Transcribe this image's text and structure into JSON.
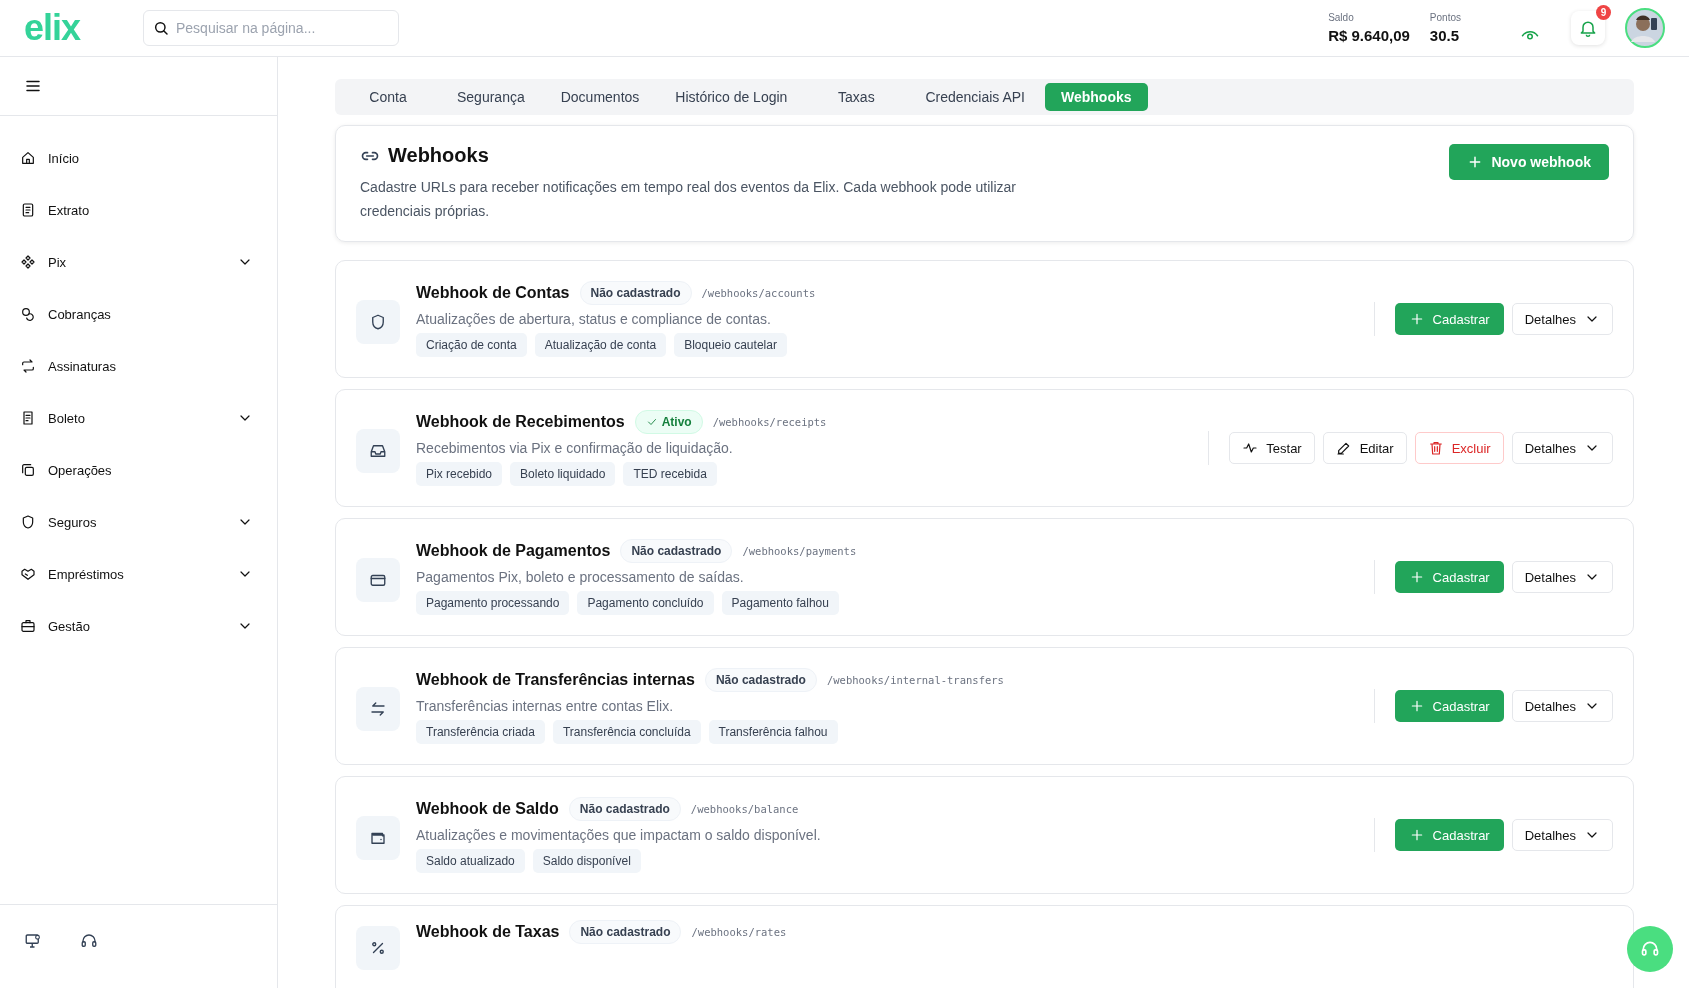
{
  "header": {
    "logo": "elix",
    "search": {
      "placeholder": "Pesquisar na página..."
    },
    "balance": {
      "label": "Saldo",
      "value": "R$ 9.640,09"
    },
    "points": {
      "label": "Pontos",
      "value": "30.5"
    },
    "notifications": {
      "count": "9"
    }
  },
  "sidebar": {
    "items": [
      {
        "label": "Início",
        "has_submenu": false
      },
      {
        "label": "Extrato",
        "has_submenu": false
      },
      {
        "label": "Pix",
        "has_submenu": true
      },
      {
        "label": "Cobranças",
        "has_submenu": false
      },
      {
        "label": "Assinaturas",
        "has_submenu": false
      },
      {
        "label": "Boleto",
        "has_submenu": true
      },
      {
        "label": "Operações",
        "has_submenu": false
      },
      {
        "label": "Seguros",
        "has_submenu": true
      },
      {
        "label": "Empréstimos",
        "has_submenu": true
      },
      {
        "label": "Gestão",
        "has_submenu": true
      }
    ]
  },
  "tabs": [
    {
      "label": "Conta",
      "selected": false
    },
    {
      "label": "Segurança",
      "selected": false
    },
    {
      "label": "Documentos",
      "selected": false
    },
    {
      "label": "Histórico de Login",
      "selected": false
    },
    {
      "label": "Taxas",
      "selected": false
    },
    {
      "label": "Credenciais API",
      "selected": false
    },
    {
      "label": "Webhooks",
      "selected": true
    }
  ],
  "intro": {
    "title": "Webhooks",
    "description": "Cadastre URLs para receber notificações em tempo real dos eventos da Elix. Cada webhook pode utilizar credenciais próprias.",
    "button": "Novo webhook"
  },
  "webhooks": [
    {
      "title": "Webhook de Contas",
      "status": {
        "label": "Não cadastrado",
        "active": false
      },
      "path": "/webhooks/accounts",
      "description": "Atualizações de abertura, status e compliance de contas.",
      "events": [
        "Criação de conta",
        "Atualização de conta",
        "Bloqueio cautelar"
      ],
      "actions": [
        {
          "label": "Cadastrar",
          "kind": "register"
        },
        {
          "label": "Detalhes",
          "kind": "details"
        }
      ]
    },
    {
      "title": "Webhook de Recebimentos",
      "status": {
        "label": "Ativo",
        "active": true
      },
      "path": "/webhooks/receipts",
      "description": "Recebimentos via Pix e confirmação de liquidação.",
      "events": [
        "Pix recebido",
        "Boleto liquidado",
        "TED recebida"
      ],
      "actions": [
        {
          "label": "Testar",
          "kind": "test"
        },
        {
          "label": "Editar",
          "kind": "edit"
        },
        {
          "label": "Excluir",
          "kind": "delete"
        },
        {
          "label": "Detalhes",
          "kind": "details"
        }
      ]
    },
    {
      "title": "Webhook de Pagamentos",
      "status": {
        "label": "Não cadastrado",
        "active": false
      },
      "path": "/webhooks/payments",
      "description": "Pagamentos Pix, boleto e processamento de saídas.",
      "events": [
        "Pagamento processando",
        "Pagamento concluído",
        "Pagamento falhou"
      ],
      "actions": [
        {
          "label": "Cadastrar",
          "kind": "register"
        },
        {
          "label": "Detalhes",
          "kind": "details"
        }
      ]
    },
    {
      "title": "Webhook de Transferências internas",
      "status": {
        "label": "Não cadastrado",
        "active": false
      },
      "path": "/webhooks/internal-transfers",
      "description": "Transferências internas entre contas Elix.",
      "events": [
        "Transferência criada",
        "Transferência concluída",
        "Transferência falhou"
      ],
      "actions": [
        {
          "label": "Cadastrar",
          "kind": "register"
        },
        {
          "label": "Detalhes",
          "kind": "details"
        }
      ]
    },
    {
      "title": "Webhook de Saldo",
      "status": {
        "label": "Não cadastrado",
        "active": false
      },
      "path": "/webhooks/balance",
      "description": "Atualizações e movimentações que impactam o saldo disponível.",
      "events": [
        "Saldo atualizado",
        "Saldo disponível"
      ],
      "actions": [
        {
          "label": "Cadastrar",
          "kind": "register"
        },
        {
          "label": "Detalhes",
          "kind": "details"
        }
      ]
    },
    {
      "title": "Webhook de Taxas",
      "status": {
        "label": "Não cadastrado",
        "active": false
      },
      "path": "/webhooks/rates"
    }
  ]
}
